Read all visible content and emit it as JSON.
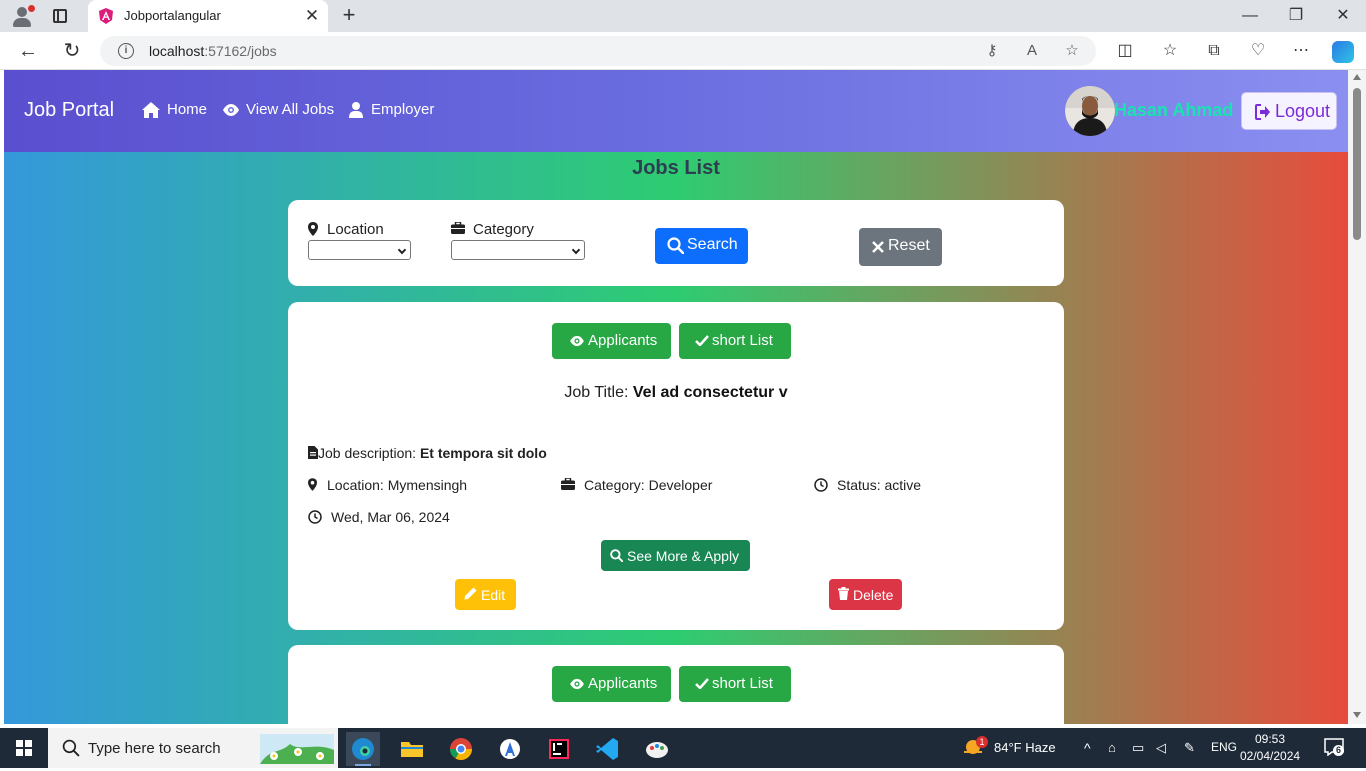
{
  "browser": {
    "tab_title": "Jobportalangular",
    "url_host": "localhost",
    "url_rest": ":57162/jobs",
    "close_tab": "✕",
    "new_tab": "+",
    "win_min": "—",
    "win_max": "❐",
    "win_close": "✕"
  },
  "nav": {
    "brand": "Job Portal",
    "home": "Home",
    "view_all": "View All Jobs",
    "employer": "Employer",
    "username": "Hasan Ahmad",
    "logout": "Logout"
  },
  "page": {
    "title": "Jobs List",
    "filters": {
      "location_label": "Location",
      "category_label": "Category",
      "location_value": "",
      "category_value": "",
      "search_btn": "Search",
      "reset_btn": "Reset"
    }
  },
  "jobs": [
    {
      "applicants_btn": "Applicants",
      "shortlist_btn": "short List",
      "title_label": "Job Title: ",
      "title": "Vel ad consectetur v",
      "desc_label": "Job description: ",
      "desc": "Et tempora sit dolo",
      "location": "Location: Mymensingh",
      "category": "Category: Developer",
      "status": "Status: active",
      "date": "Wed, Mar 06, 2024",
      "see_more_btn": "See More & Apply",
      "edit_btn": "Edit",
      "delete_btn": "Delete"
    },
    {
      "applicants_btn": "Applicants",
      "shortlist_btn": "short List"
    }
  ],
  "taskbar": {
    "search_placeholder": "Type here to search",
    "weather": "84°F  Haze",
    "weather_badge": "1",
    "lang": "ENG",
    "time": "09:53",
    "date": "02/04/2024",
    "notif_count": "6"
  },
  "colors": {
    "primary": "#0d6efd",
    "success": "#28a745",
    "dark_success": "#198754",
    "warning": "#ffc107",
    "danger": "#dc3545",
    "secondary": "#6c757d"
  }
}
